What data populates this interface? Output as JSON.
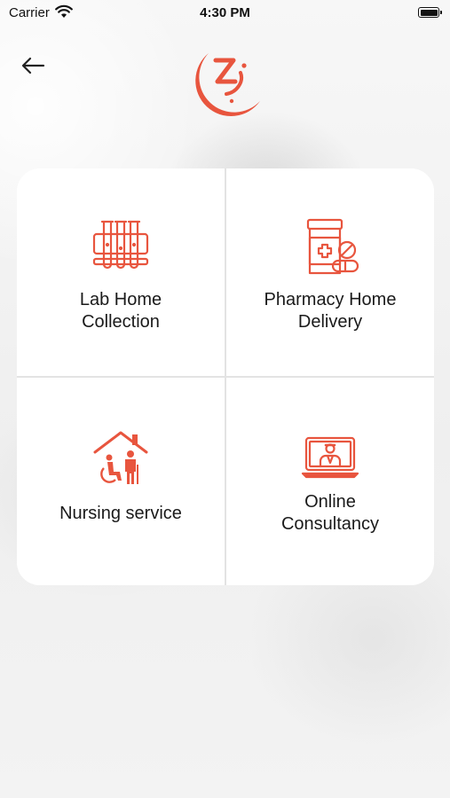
{
  "status_bar": {
    "carrier": "Carrier",
    "time": "4:30 PM"
  },
  "colors": {
    "accent": "#e8553e",
    "card": "#ffffff",
    "divider": "#e3e3e3",
    "text": "#1a1a1a"
  },
  "header": {
    "back_icon": "arrow-left-icon",
    "logo_icon": "crescent-z-logo"
  },
  "services": [
    {
      "line1": "Lab Home",
      "line2": "Collection",
      "icon": "test-tubes-icon"
    },
    {
      "line1": "Pharmacy Home",
      "line2": "Delivery",
      "icon": "medicine-bottle-icon"
    },
    {
      "line1": "Nursing service",
      "line2": "",
      "icon": "home-care-icon"
    },
    {
      "line1": "Online",
      "line2": "Consultancy",
      "icon": "laptop-doctor-icon"
    }
  ]
}
